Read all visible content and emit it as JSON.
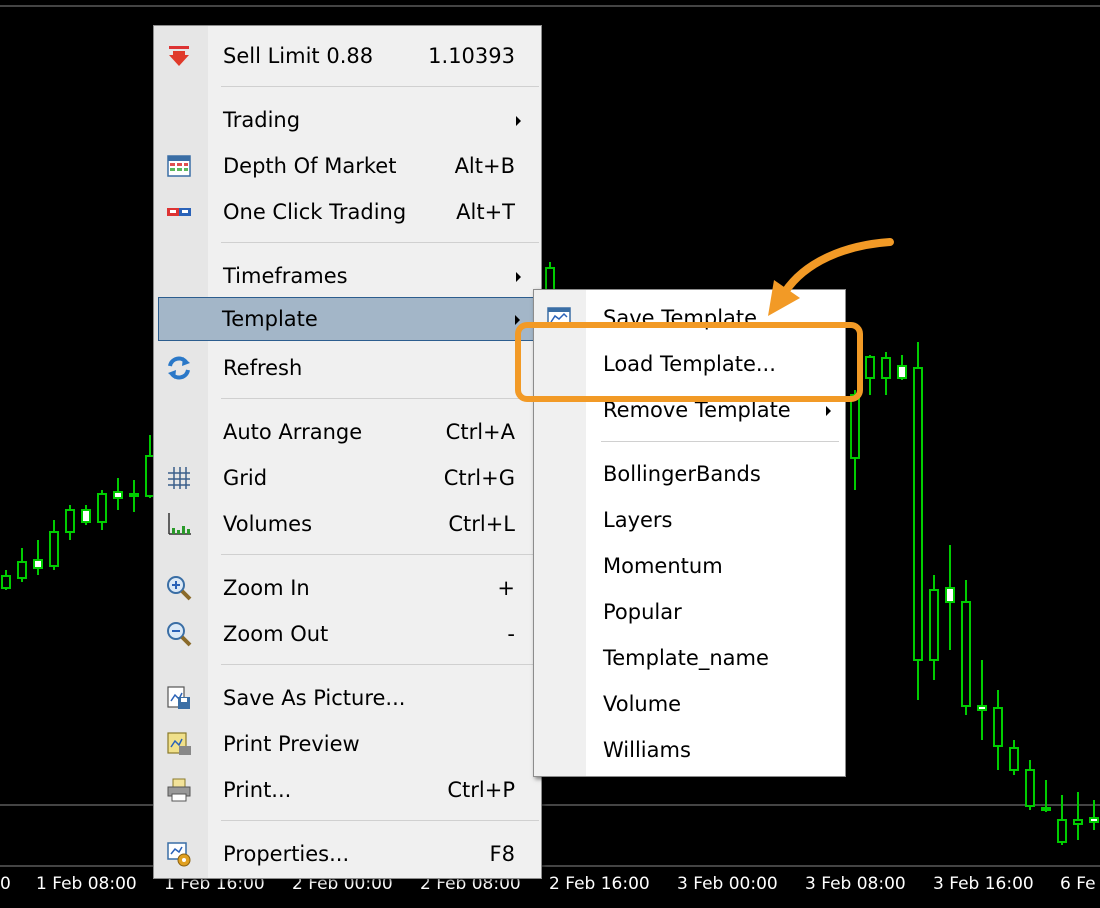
{
  "context_menu": {
    "sell_limit": {
      "label": "Sell Limit 0.88",
      "price": "1.10393",
      "icon": "sell-arrow-icon"
    },
    "items": [
      {
        "label": "Trading",
        "shortcut": "",
        "submenu": true
      },
      {
        "label": "Depth Of Market",
        "shortcut": "Alt+B",
        "icon": "depth-of-market-icon"
      },
      {
        "label": "One Click Trading",
        "shortcut": "Alt+T",
        "icon": "one-click-trading-icon"
      },
      {
        "label": "Timeframes",
        "shortcut": "",
        "submenu": true
      },
      {
        "label": "Template",
        "shortcut": "",
        "submenu": true,
        "highlighted": true
      },
      {
        "label": "Refresh",
        "shortcut": "",
        "icon": "refresh-icon"
      },
      {
        "label": "Auto Arrange",
        "shortcut": "Ctrl+A"
      },
      {
        "label": "Grid",
        "shortcut": "Ctrl+G",
        "icon": "grid-icon"
      },
      {
        "label": "Volumes",
        "shortcut": "Ctrl+L",
        "icon": "volumes-icon"
      },
      {
        "label": "Zoom In",
        "shortcut": "+",
        "icon": "zoom-in-icon"
      },
      {
        "label": "Zoom Out",
        "shortcut": "-",
        "icon": "zoom-out-icon"
      },
      {
        "label": "Save As Picture...",
        "shortcut": "",
        "icon": "save-picture-icon"
      },
      {
        "label": "Print Preview",
        "shortcut": "",
        "icon": "print-preview-icon"
      },
      {
        "label": "Print...",
        "shortcut": "Ctrl+P",
        "icon": "printer-icon"
      },
      {
        "label": "Properties...",
        "shortcut": "F8",
        "icon": "properties-icon"
      }
    ]
  },
  "template_submenu": {
    "items": [
      {
        "label": "Save Template...",
        "icon": "save-template-icon"
      },
      {
        "label": "Load Template...",
        "highlighted": true
      },
      {
        "label": "Remove Template",
        "submenu": true
      },
      {
        "label": "BollingerBands"
      },
      {
        "label": "Layers"
      },
      {
        "label": "Momentum"
      },
      {
        "label": "Popular"
      },
      {
        "label": "Template_name"
      },
      {
        "label": "Volume"
      },
      {
        "label": "Williams"
      }
    ]
  },
  "time_axis": [
    "0",
    "1 Feb 08:00",
    "1 Feb 16:00",
    "2 Feb 00:00",
    "2 Feb 08:00",
    "2 Feb 16:00",
    "3 Feb 00:00",
    "3 Feb 08:00",
    "3 Feb 16:00",
    "6 Fe"
  ],
  "colors": {
    "candle": "#00cc00",
    "highlight": "#f29a26",
    "menu_hover": "#a3b6c8",
    "background": "#000000"
  }
}
